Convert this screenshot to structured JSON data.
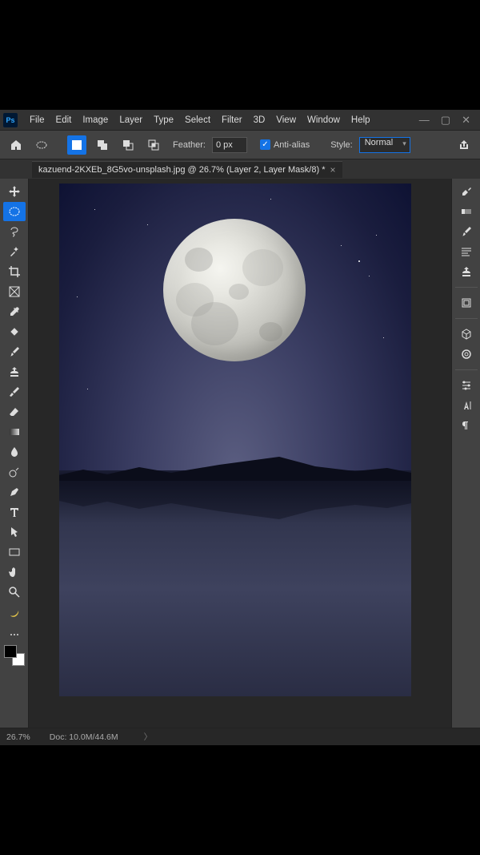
{
  "menu": {
    "items": [
      "File",
      "Edit",
      "Image",
      "Layer",
      "Type",
      "Select",
      "Filter",
      "3D",
      "View",
      "Window",
      "Help"
    ]
  },
  "options_bar": {
    "feather_label": "Feather:",
    "feather_value": "0 px",
    "antialias_label": "Anti-alias",
    "style_label": "Style:",
    "style_value": "Normal"
  },
  "document_tab": {
    "title": "kazuend-2KXEb_8G5vo-unsplash.jpg @ 26.7% (Layer 2, Layer Mask/8) *"
  },
  "status": {
    "zoom": "26.7%",
    "doc_info": "Doc: 10.0M/44.6M"
  },
  "left_tools": [
    {
      "name": "move-tool",
      "active": false
    },
    {
      "name": "elliptical-marquee-tool",
      "active": true
    },
    {
      "name": "lasso-tool",
      "active": false
    },
    {
      "name": "magic-wand-tool",
      "active": false
    },
    {
      "name": "crop-tool",
      "active": false
    },
    {
      "name": "frame-tool",
      "active": false
    },
    {
      "name": "eyedropper-tool",
      "active": false
    },
    {
      "name": "healing-brush-tool",
      "active": false
    },
    {
      "name": "brush-tool",
      "active": false
    },
    {
      "name": "clone-stamp-tool",
      "active": false
    },
    {
      "name": "history-brush-tool",
      "active": false
    },
    {
      "name": "eraser-tool",
      "active": false
    },
    {
      "name": "gradient-tool",
      "active": false
    },
    {
      "name": "blur-tool",
      "active": false
    },
    {
      "name": "dodge-tool",
      "active": false
    },
    {
      "name": "pen-tool",
      "active": false
    },
    {
      "name": "type-tool",
      "active": false
    },
    {
      "name": "path-selection-tool",
      "active": false
    },
    {
      "name": "rectangle-tool",
      "active": false
    },
    {
      "name": "hand-tool",
      "active": false
    },
    {
      "name": "zoom-tool",
      "active": false
    },
    {
      "name": "banana-tool",
      "active": false
    }
  ],
  "right_tools": [
    {
      "name": "properties-icon"
    },
    {
      "name": "color-icon"
    },
    {
      "name": "swatches-icon"
    },
    {
      "name": "paragraph-icon"
    },
    {
      "name": "stamp-icon"
    },
    {
      "name": "libraries-icon"
    },
    {
      "name": "3d-icon"
    },
    {
      "name": "cloud-icon"
    },
    {
      "name": "adjustments-icon"
    },
    {
      "name": "character-icon"
    },
    {
      "name": "paragraph-styles-icon"
    }
  ],
  "colors": {
    "accent": "#1473e6",
    "panel": "#424242",
    "bg": "#272727"
  }
}
